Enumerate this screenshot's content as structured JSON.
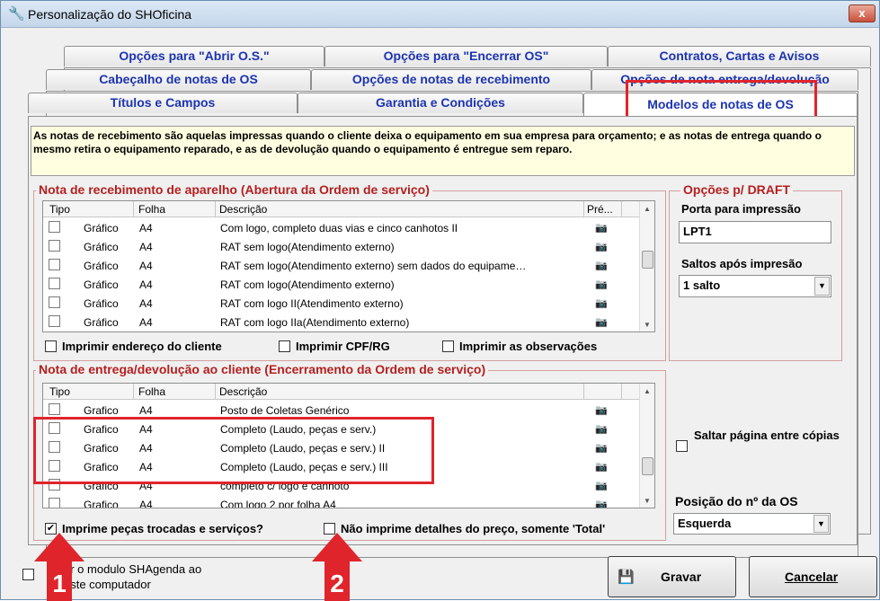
{
  "window": {
    "title": "Personalização do SHOficina",
    "close_label": "x"
  },
  "tabs": {
    "row1": [
      "Opções para \"Abrir O.S.\"",
      "Opções para \"Encerrar OS\"",
      "Contratos, Cartas e Avisos"
    ],
    "row2": [
      "Cabeçalho de notas de OS",
      "Opções de notas de recebimento",
      "Opções de nota entrega/devolução"
    ],
    "row3": [
      "Títulos e Campos",
      "Garantia e Condições",
      "Modelos de notas de OS"
    ]
  },
  "info": "As notas de recebimento são aquelas impressas quando o cliente deixa o equipamento em sua empresa para orçamento; e as notas de entrega quando o mesmo retira o equipamento reparado, e as de devolução quando o equipamento é entregue sem reparo.",
  "receb": {
    "title": "Nota de recebimento de aparelho (Abertura da Ordem de serviço)",
    "headers": {
      "tipo": "Tipo",
      "folha": "Folha",
      "desc": "Descrição",
      "pre": "Pré..."
    },
    "rows": [
      {
        "tipo": "Gráfico",
        "folha": "A4",
        "desc": "Com logo, completo duas vias e cinco canhotos II"
      },
      {
        "tipo": "Gráfico",
        "folha": "A4",
        "desc": "RAT sem logo(Atendimento externo)"
      },
      {
        "tipo": "Gráfico",
        "folha": "A4",
        "desc": "RAT sem logo(Atendimento externo) sem dados do equipame…"
      },
      {
        "tipo": "Gráfico",
        "folha": "A4",
        "desc": "RAT com logo(Atendimento externo)"
      },
      {
        "tipo": "Gráfico",
        "folha": "A4",
        "desc": "RAT com logo II(Atendimento externo)"
      },
      {
        "tipo": "Gráfico",
        "folha": "A4",
        "desc": "RAT com logo IIa(Atendimento externo)"
      }
    ],
    "opts": [
      "Imprimir endereço do cliente",
      "Imprimir CPF/RG",
      "Imprimir as observações"
    ]
  },
  "entrega": {
    "title": "Nota de entrega/devolução ao cliente (Encerramento da Ordem de serviço)",
    "headers": {
      "tipo": "Tipo",
      "folha": "Folha",
      "desc": "Descrição"
    },
    "rows": [
      {
        "tipo": "Grafico",
        "folha": "A4",
        "desc": "Posto de Coletas Genérico"
      },
      {
        "tipo": "Grafico",
        "folha": "A4",
        "desc": "Completo (Laudo, peças e serv.)"
      },
      {
        "tipo": "Grafico",
        "folha": "A4",
        "desc": "Completo (Laudo, peças e serv.) II"
      },
      {
        "tipo": "Grafico",
        "folha": "A4",
        "desc": "Completo (Laudo, peças e serv.) III"
      },
      {
        "tipo": "Grafico",
        "folha": "A4",
        "desc": "completo c/ logo e canhoto"
      },
      {
        "tipo": "Grafico",
        "folha": "A4",
        "desc": "Com logo 2 por folha A4"
      }
    ],
    "opt1": "Imprime peças trocadas e serviços?",
    "opt2": "Não imprime detalhes do preço, somente 'Total'"
  },
  "draft": {
    "title": "Opções p/ DRAFT",
    "porta_label": "Porta para impressão",
    "porta_value": "LPT1",
    "saltos_label": "Saltos após impresão",
    "saltos_value": "1 salto"
  },
  "saltar": "Saltar página entre cópias",
  "posicao": {
    "label": "Posição do nº da OS",
    "value": "Esquerda"
  },
  "bottom": {
    "shagenda": "ar o modulo SHAgenda ao",
    "computador": "este computador",
    "gravar": "Gravar",
    "cancelar": "Cancelar"
  },
  "callouts": {
    "one": "1",
    "two": "2",
    "color": "#e0242b"
  }
}
